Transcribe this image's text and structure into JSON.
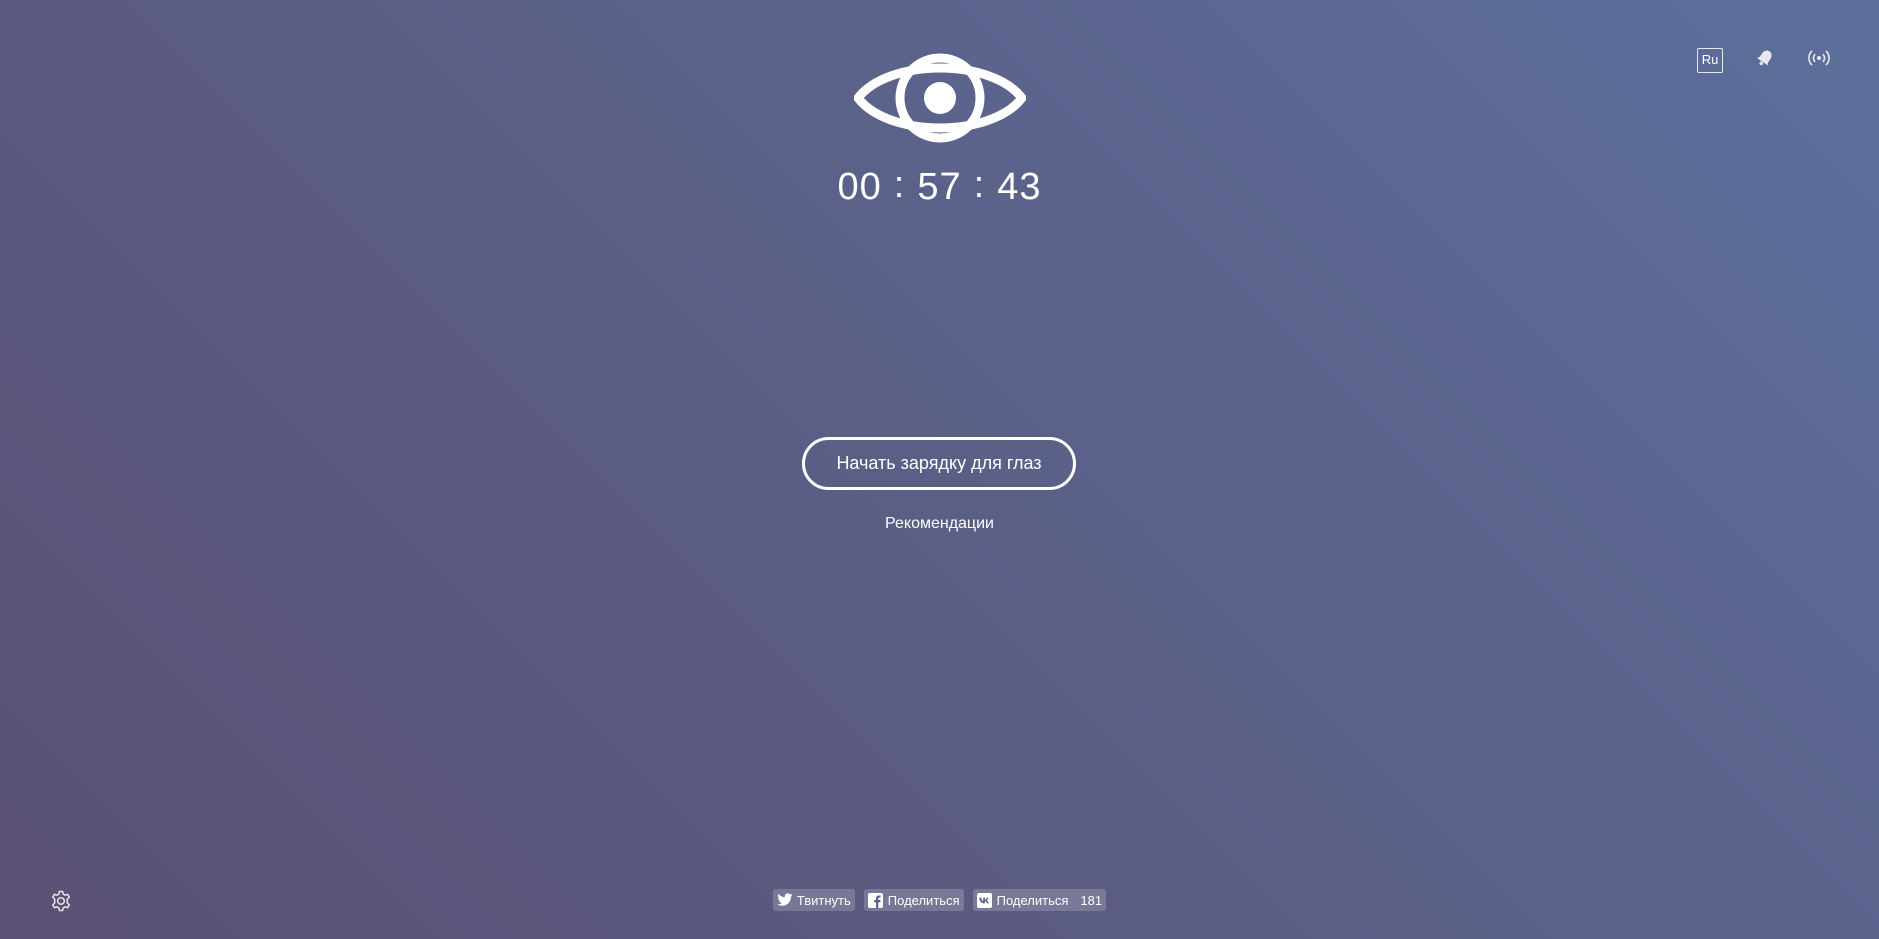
{
  "header": {
    "language_label": "Ru",
    "icons": {
      "notification": "bell-icon",
      "broadcast": "broadcast-icon"
    }
  },
  "eye": {
    "icon": "eye-icon"
  },
  "timer": {
    "hours": "00",
    "minutes": "57",
    "seconds": "43",
    "separator": ":"
  },
  "main": {
    "start_label": "Начать зарядку для глаз",
    "recommendations_label": "Рекомендации"
  },
  "settings": {
    "icon": "gear-icon"
  },
  "share": {
    "twitter_label": "Твитнуть",
    "facebook_label": "Поделиться",
    "vk_label": "Поделиться",
    "vk_count": "181"
  },
  "colors": {
    "background_start": "#5a5073",
    "background_end": "#5c6f9c",
    "foreground": "#ffffff"
  }
}
